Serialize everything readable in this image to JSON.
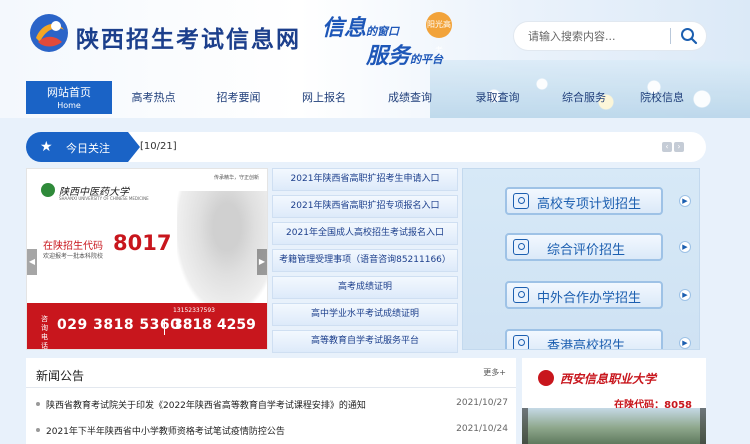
{
  "header": {
    "site_title": "陕西招生考试信息网",
    "slogan_line1_a": "信息",
    "slogan_line1_b": "的窗口",
    "slogan_line2_a": "服务",
    "slogan_line2_b": "的平台",
    "slogan_seal": "阳光高考",
    "search_placeholder": "请输入搜索内容..."
  },
  "nav": {
    "home_label": "网站首页",
    "home_sub": "Home",
    "items": [
      "高考热点",
      "招考要闻",
      "网上报名",
      "成绩查询",
      "录取查询",
      "综合服务",
      "院校信息"
    ]
  },
  "today": {
    "label": "今日关注",
    "date": "[10/21]"
  },
  "banner": {
    "university": "陕西中医药大学",
    "university_en": "SHAANXI UNIVERSITY OF CHINESE MEDICINE",
    "slogan": "传承精华，守正创新",
    "code_label": "在陕招生代码",
    "code": "8017",
    "welcome": "欢迎报考一批本科院校",
    "tel_tag": "咨询电话",
    "phone1": "029 3818 5360",
    "phone2": "3818 4259",
    "mobile": "13152337593"
  },
  "links": [
    "2021年陕西省高职扩招考生申请入口",
    "2021年陕西省高职扩招专项报名入口",
    "2021年全国成人高校招生考试报名入口",
    "考籍管理受理事项（语音咨询85211166）",
    "高考成绩证明",
    "高中学业水平考试成绩证明",
    "高等教育自学考试服务平台"
  ],
  "right_panel": {
    "buttons": [
      "高校专项计划招生",
      "综合评价招生",
      "中外合作办学招生",
      "香港高校招生"
    ]
  },
  "news": {
    "title": "新闻公告",
    "more": "更多+",
    "items": [
      {
        "text": "陕西省教育考试院关于印发《2022年陕西省高等教育自学考试课程安排》的通知",
        "date": "2021/10/27"
      },
      {
        "text": "2021年下半年陕西省中小学教师资格考试笔试疫情防控公告",
        "date": "2021/10/24"
      }
    ]
  },
  "ad": {
    "name": "西安信息职业大学",
    "code": "在陕代码：8058"
  },
  "colors": {
    "primary": "#1a63c6",
    "title": "#1c3f8c",
    "red": "#c8161d"
  }
}
